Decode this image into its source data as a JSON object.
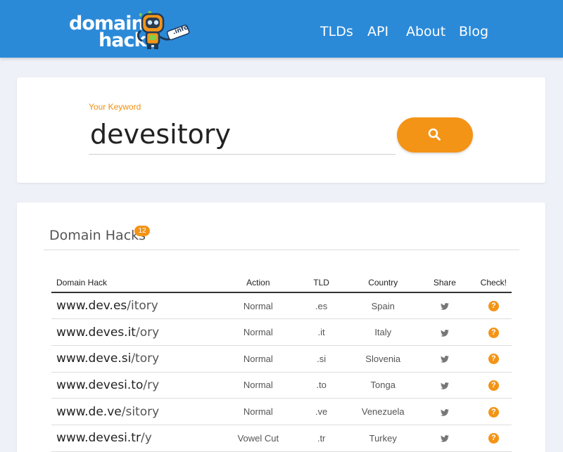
{
  "header": {
    "logo_line1": "domain",
    "logo_line2": "hacks",
    "logo_badge": ".info",
    "nav": [
      "TLDs",
      "API",
      "About",
      "Blog"
    ]
  },
  "search": {
    "label": "Your Keyword",
    "value": "devesitory"
  },
  "results": {
    "title": "Domain Hacks",
    "count": "12",
    "columns": [
      "Domain Hack",
      "Action",
      "TLD",
      "Country",
      "Share",
      "Check!"
    ],
    "rows": [
      {
        "domain": "www.dev.es",
        "path": "/itory",
        "action": "Normal",
        "tld": ".es",
        "country": "Spain"
      },
      {
        "domain": "www.deves.it",
        "path": "/ory",
        "action": "Normal",
        "tld": ".it",
        "country": "Italy"
      },
      {
        "domain": "www.deve.si",
        "path": "/tory",
        "action": "Normal",
        "tld": ".si",
        "country": "Slovenia"
      },
      {
        "domain": "www.devesi.to",
        "path": "/ry",
        "action": "Normal",
        "tld": ".to",
        "country": "Tonga"
      },
      {
        "domain": "www.de.ve",
        "path": "/sitory",
        "action": "Normal",
        "tld": ".ve",
        "country": "Venezuela"
      },
      {
        "domain": "www.devesi.tr",
        "path": "/y",
        "action": "Vowel Cut",
        "tld": ".tr",
        "country": "Turkey"
      }
    ]
  },
  "icons": {
    "share": "twitter-icon",
    "check": "help-icon",
    "search": "search-icon"
  },
  "colors": {
    "header": "#2b8ad8",
    "accent": "#f39417"
  }
}
